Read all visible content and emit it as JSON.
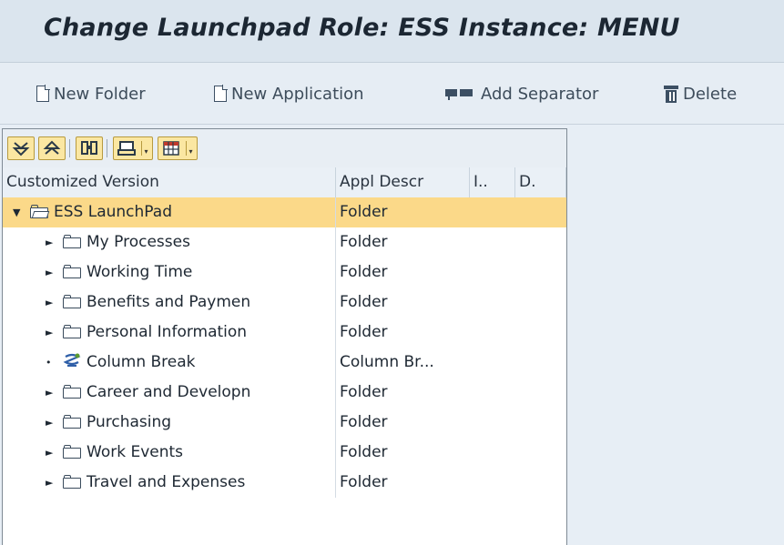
{
  "header": {
    "title": "Change Launchpad Role: ESS Instance: MENU"
  },
  "toolbar": {
    "new_folder": {
      "label": "New Folder",
      "icon": "new-document-icon"
    },
    "new_application": {
      "label": "New Application",
      "icon": "new-document-icon"
    },
    "add_separator": {
      "label": "Add Separator",
      "icon": "separator-icon"
    },
    "delete": {
      "label": "Delete",
      "icon": "trash-icon"
    }
  },
  "tree_toolbar": {
    "buttons": [
      "expand-all-icon",
      "collapse-all-icon",
      "find-icon",
      "print-icon",
      "layout-grid-icon"
    ]
  },
  "columns": [
    "Customized Version",
    "Appl Descr",
    "I..",
    "D."
  ],
  "rows": [
    {
      "label": "ESS LaunchPad",
      "descr": "Folder",
      "level": 0,
      "expander": "▼",
      "icon": "folder-open-icon",
      "selected": true
    },
    {
      "label": "My Processes",
      "descr": "Folder",
      "level": 1,
      "expander": "►",
      "icon": "folder-icon",
      "selected": false
    },
    {
      "label": "Working Time",
      "descr": "Folder",
      "level": 1,
      "expander": "►",
      "icon": "folder-icon",
      "selected": false
    },
    {
      "label": "Benefits and Paymen",
      "descr": "Folder",
      "level": 1,
      "expander": "►",
      "icon": "folder-icon",
      "selected": false
    },
    {
      "label": "Personal Information",
      "descr": "Folder",
      "level": 1,
      "expander": "►",
      "icon": "folder-icon",
      "selected": false
    },
    {
      "label": "Column Break",
      "descr": "Column Br...",
      "level": 1,
      "expander": "•",
      "icon": "column-break-icon",
      "selected": false
    },
    {
      "label": "Career and Developn",
      "descr": "Folder",
      "level": 1,
      "expander": "►",
      "icon": "folder-icon",
      "selected": false
    },
    {
      "label": "Purchasing",
      "descr": "Folder",
      "level": 1,
      "expander": "►",
      "icon": "folder-icon",
      "selected": false
    },
    {
      "label": "Work Events",
      "descr": "Folder",
      "level": 1,
      "expander": "►",
      "icon": "folder-icon",
      "selected": false
    },
    {
      "label": "Travel and Expenses",
      "descr": "Folder",
      "level": 1,
      "expander": "►",
      "icon": "folder-icon",
      "selected": false
    }
  ],
  "colors": {
    "selected_row": "#fbd989",
    "button_fill": "#fbe7a2"
  }
}
